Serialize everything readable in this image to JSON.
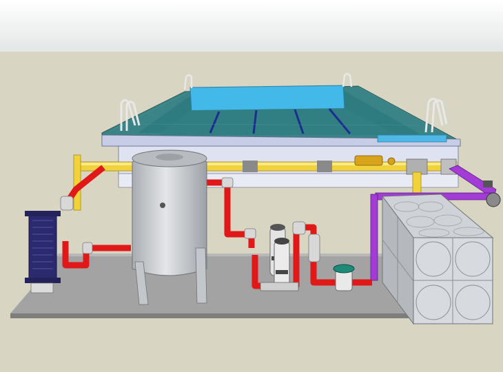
{
  "scene": {
    "sky_color": "#e8eaea",
    "ground_color": "#d8d5c2",
    "colors": {
      "hot_pipe": "#e01818",
      "supply_pipe": "#f2d23a",
      "return_pipe": "#a33bd6",
      "pool_water": "#3fb6e6",
      "pool_tile": "#2e6f74",
      "tank_steel": "#c9ccd0",
      "heat_exchanger": "#2c2a6e",
      "platform": "#9a9a9a"
    },
    "components": [
      {
        "name": "swimming-pool",
        "icon": "pool-icon"
      },
      {
        "name": "heat-exchanger",
        "icon": "plate-heat-exchanger-icon"
      },
      {
        "name": "pressure-vessel",
        "icon": "tank-icon"
      },
      {
        "name": "circulation-pumps",
        "icon": "pump-icon"
      },
      {
        "name": "hair-filter",
        "icon": "filter-icon"
      },
      {
        "name": "sectional-water-tank",
        "icon": "water-tank-icon"
      }
    ]
  }
}
